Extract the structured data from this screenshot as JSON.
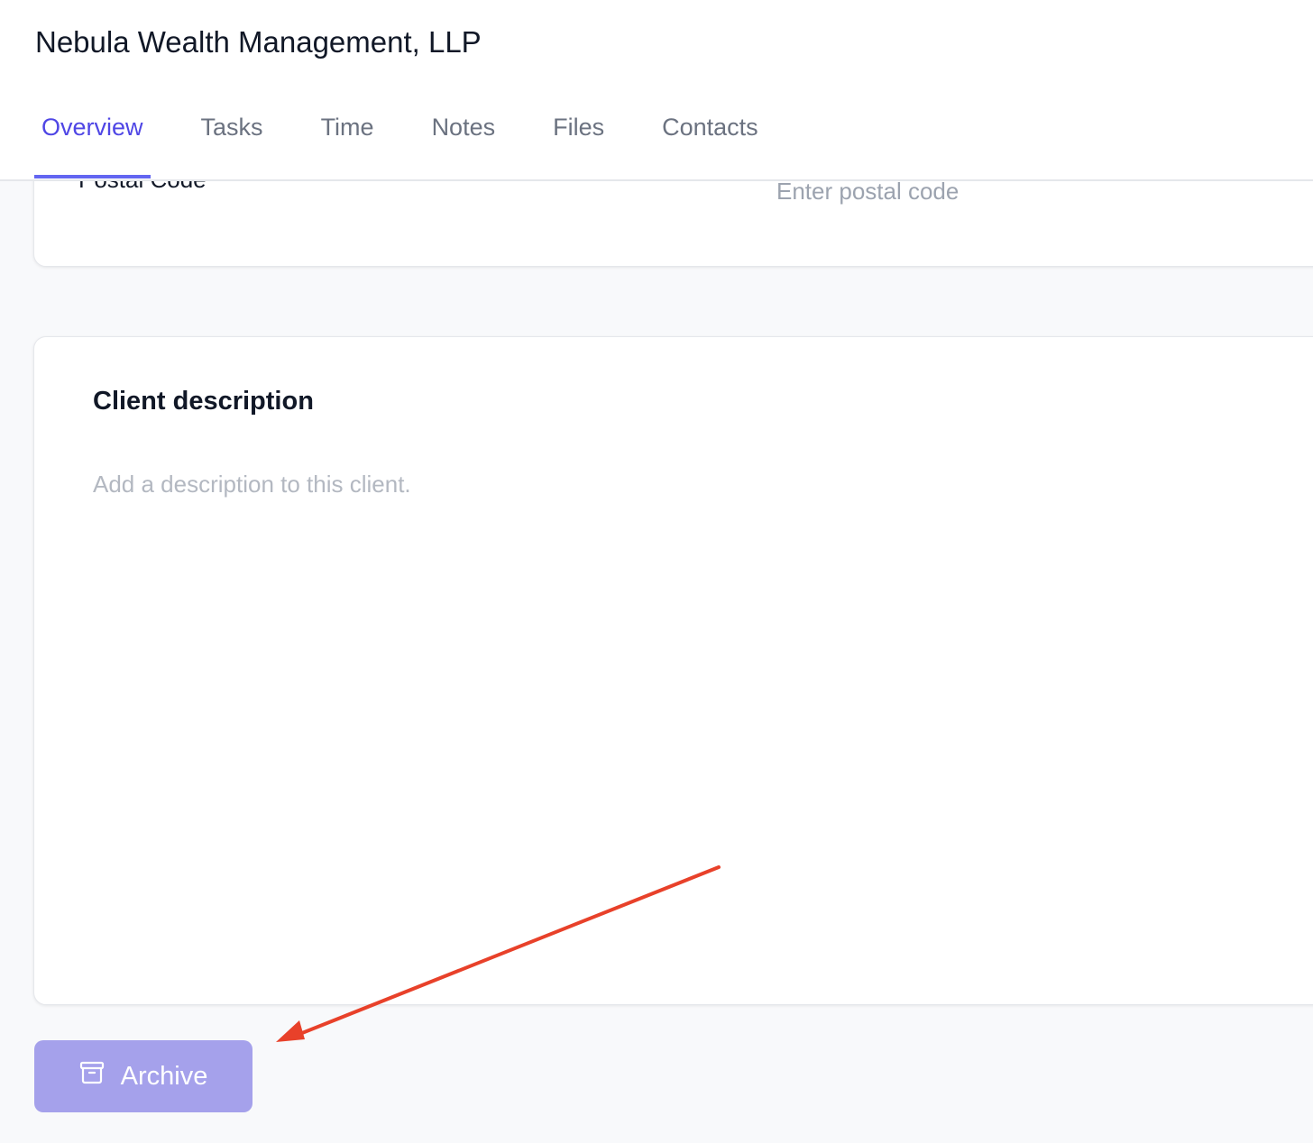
{
  "header": {
    "title": "Nebula Wealth Management, LLP"
  },
  "tabs": [
    {
      "label": "Overview",
      "active": true
    },
    {
      "label": "Tasks"
    },
    {
      "label": "Time"
    },
    {
      "label": "Notes"
    },
    {
      "label": "Files"
    },
    {
      "label": "Contacts"
    }
  ],
  "address": {
    "postal_code_label": "Postal Code",
    "postal_code_placeholder": "Enter postal code",
    "postal_code_value": ""
  },
  "description": {
    "title": "Client description",
    "placeholder": "Add a description to this client.",
    "value": ""
  },
  "actions": {
    "archive_label": "Archive",
    "archive_icon": "archive-box-icon"
  },
  "annotation": {
    "arrow_color": "#e8412a"
  },
  "colors": {
    "accent": "#4f46e5",
    "archive_button": "#a5a1eb"
  }
}
